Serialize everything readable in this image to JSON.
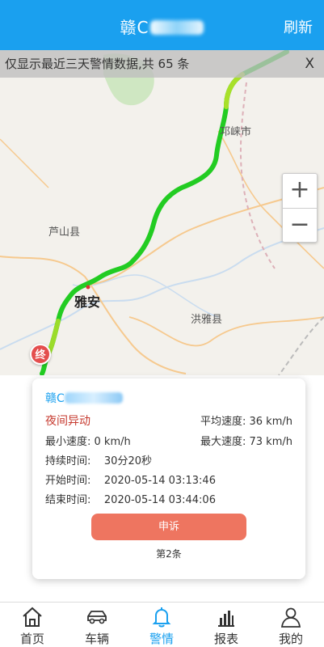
{
  "header": {
    "title_prefix": "赣C",
    "refresh_label": "刷新"
  },
  "notice": {
    "text": "仅显示最近三天警情数据,共 65 条",
    "close_label": "X"
  },
  "map": {
    "labels": {
      "luoshan": "芦山县",
      "yaan": "雅安",
      "hongya": "洪雅县",
      "qionglai": "邛崃市"
    },
    "zoom_in": "+",
    "zoom_out": "−",
    "end_marker": "终"
  },
  "card": {
    "plate_prefix": "赣C",
    "alarm_type": "夜间异动",
    "avg_speed": "平均速度: 36 km/h",
    "min_speed": "最小速度: 0 km/h",
    "max_speed": "最大速度: 73 km/h",
    "duration": "持续时间:    30分20秒",
    "start_time": "开始时间:    2020-05-14 03:13:46",
    "end_time": "结束时间:    2020-05-14 03:44:06",
    "appeal_label": "申诉",
    "pager": "第2条"
  },
  "tabs": [
    {
      "label": "首页",
      "icon": "home-icon"
    },
    {
      "label": "车辆",
      "icon": "car-icon"
    },
    {
      "label": "警情",
      "icon": "bell-icon"
    },
    {
      "label": "报表",
      "icon": "bar-chart-icon"
    },
    {
      "label": "我的",
      "icon": "user-icon"
    }
  ],
  "colors": {
    "accent": "#1aa0ef",
    "alarm": "#c63a2f",
    "appeal": "#ee7560",
    "route_green": "#33cc33"
  }
}
